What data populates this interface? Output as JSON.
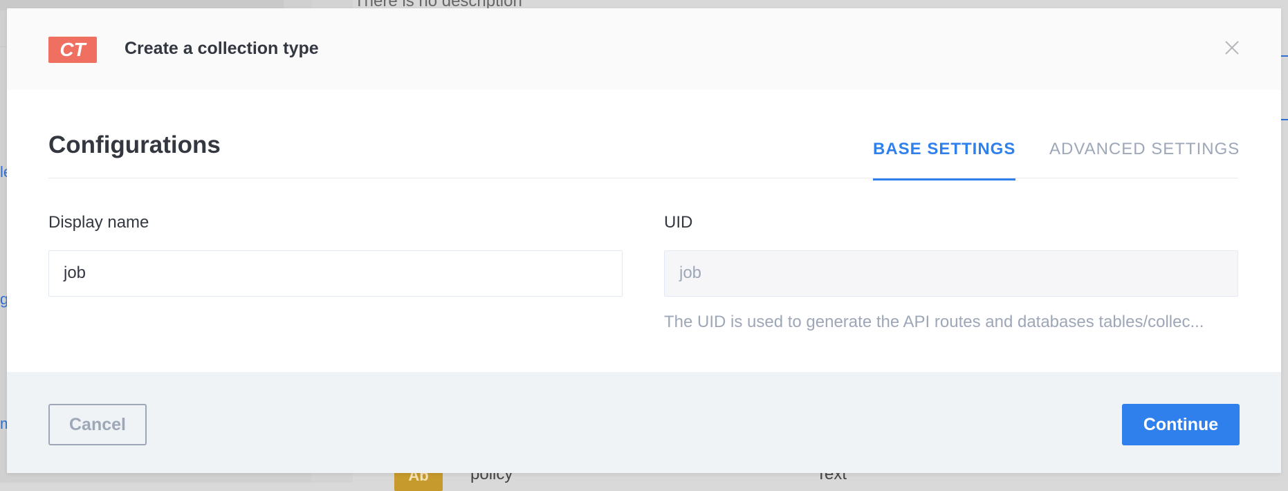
{
  "background": {
    "description_text": "There is no description",
    "left_links": [
      "le",
      "g",
      "m"
    ],
    "row": {
      "badge": "Ab",
      "field_name": "policy",
      "field_type": "Text"
    }
  },
  "modal": {
    "badge": "CT",
    "title": "Create a collection type",
    "close_icon": "close-icon",
    "section_title": "Configurations",
    "tabs": [
      {
        "label": "BASE SETTINGS",
        "active": true
      },
      {
        "label": "ADVANCED SETTINGS",
        "active": false
      }
    ],
    "fields": {
      "display_name": {
        "label": "Display name",
        "value": "job"
      },
      "uid": {
        "label": "UID",
        "value": "job",
        "help": "The UID is used to generate the API routes and databases tables/collec..."
      }
    },
    "footer": {
      "cancel_label": "Cancel",
      "continue_label": "Continue"
    }
  },
  "colors": {
    "accent": "#2f80ed",
    "badge": "#ef6f60",
    "muted_text": "#9ea7b8"
  }
}
